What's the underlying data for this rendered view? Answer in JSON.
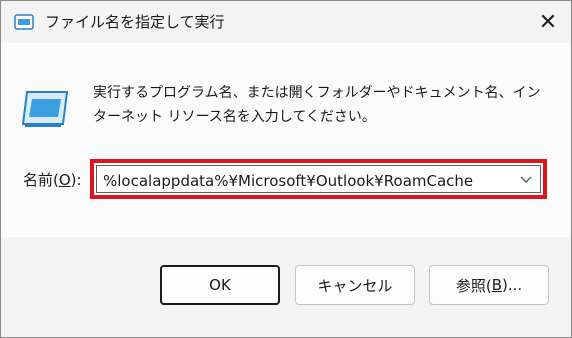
{
  "window": {
    "title": "ファイル名を指定して実行",
    "close_glyph": "✕"
  },
  "description": {
    "line1": "実行するプログラム名、または開くフォルダーやドキュメント名、イン",
    "line2": "ターネット リソース名を入力してください。"
  },
  "name_field": {
    "label_pre": "名前(",
    "label_key": "O",
    "label_post": "):",
    "value": "%localappdata%¥Microsoft¥Outlook¥RoamCache"
  },
  "buttons": {
    "ok": "OK",
    "cancel": "キャンセル",
    "browse_pre": "参照(",
    "browse_key": "B",
    "browse_post": ")..."
  },
  "colors": {
    "highlight": "#e0141f",
    "icon_blue": "#3b9ee0"
  }
}
